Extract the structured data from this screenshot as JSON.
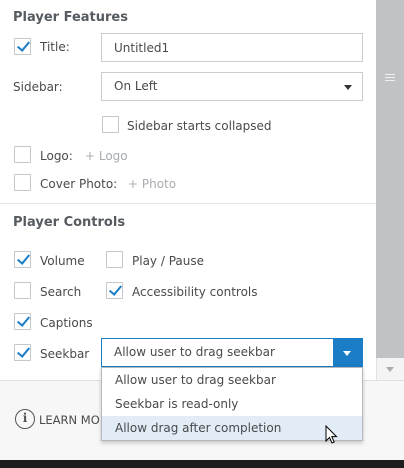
{
  "player_features": {
    "heading": "Player Features",
    "title": {
      "label": "Title:",
      "checked": true,
      "value": "Untitled1"
    },
    "sidebar": {
      "label": "Sidebar:",
      "selected": "On Left"
    },
    "sidebar_collapsed": {
      "label": "Sidebar starts collapsed",
      "checked": false
    },
    "logo": {
      "label": "Logo:",
      "placeholder": "+ Logo",
      "checked": false
    },
    "cover_photo": {
      "label": "Cover Photo:",
      "placeholder": "+ Photo",
      "checked": false
    }
  },
  "player_controls": {
    "heading": "Player Controls",
    "volume": {
      "label": "Volume",
      "checked": true
    },
    "play_pause": {
      "label": "Play / Pause",
      "checked": false
    },
    "search": {
      "label": "Search",
      "checked": false
    },
    "accessibility": {
      "label": "Accessibility controls",
      "checked": true
    },
    "captions": {
      "label": "Captions",
      "checked": true
    },
    "seekbar": {
      "label": "Seekbar",
      "checked": true,
      "selected": "Allow user to drag seekbar",
      "options": [
        "Allow user to drag seekbar",
        "Seekbar is read-only",
        "Allow drag after completion"
      ],
      "hovered_option": "Allow drag after completion"
    }
  },
  "footer": {
    "info_icon": "info-icon",
    "learn_text": "LEARN MO"
  },
  "colors": {
    "accent": "#1a7dc5",
    "hover": "#e1ecf7"
  }
}
